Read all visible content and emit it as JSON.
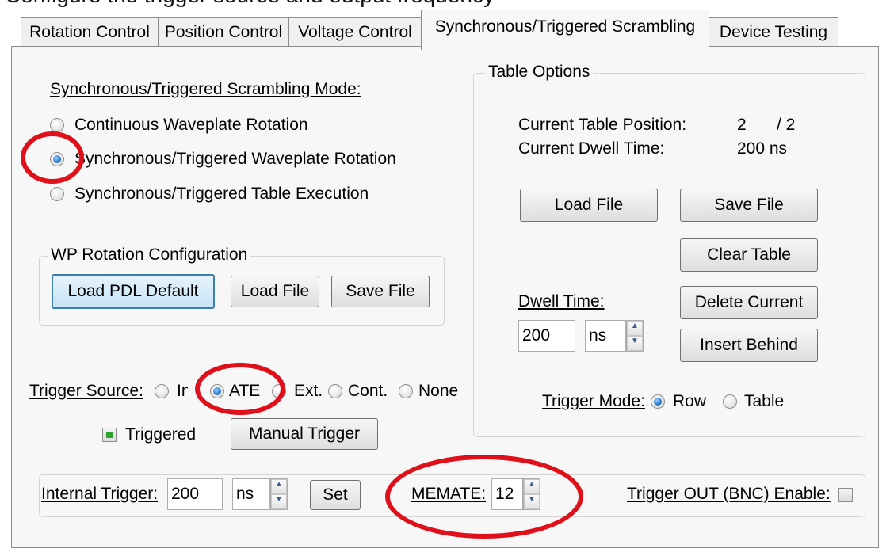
{
  "top_caption": "Configure the trigger source and output frequency",
  "tabs": [
    "Rotation Control",
    "Position Control",
    "Voltage Control",
    "Synchronous/Triggered Scrambling",
    "Device Testing"
  ],
  "mode": {
    "heading": "Synchronous/Triggered Scrambling Mode:",
    "options": [
      "Continuous Waveplate Rotation",
      "Synchronous/Triggered Waveplate Rotation",
      "Synchronous/Triggered Table Execution"
    ],
    "selected_index": 1
  },
  "wp_config": {
    "legend": "WP Rotation Configuration",
    "load_default": "Load PDL Default",
    "load_file": "Load File",
    "save_file": "Save File"
  },
  "trigger_source": {
    "label": "Trigger Source:",
    "options": [
      "Int.",
      "ATE",
      "Ext.",
      "Cont.",
      "None"
    ],
    "selected": "ATE"
  },
  "triggered": {
    "label": "Triggered",
    "checked": true
  },
  "manual_trigger": "Manual Trigger",
  "table_options": {
    "legend": "Table Options",
    "position_label": "Current Table Position:",
    "position_value": "2",
    "position_total": "/ 2",
    "dwell_label": "Current Dwell Time:",
    "dwell_value": "200 ns",
    "load_file": "Load File",
    "save_file": "Save File",
    "clear_table": "Clear Table",
    "delete_current": "Delete Current",
    "insert_behind": "Insert Behind",
    "dwell_time_label": "Dwell Time:",
    "dwell_time_value": "200",
    "dwell_unit": "ns",
    "trigger_mode_label": "Trigger Mode:",
    "trigger_modes": [
      "Row",
      "Table"
    ],
    "trigger_mode_selected": "Row"
  },
  "bottom": {
    "internal_trigger_label": "Internal Trigger:",
    "internal_trigger_value": "200",
    "internal_trigger_unit": "ns",
    "set": "Set",
    "memate_label": "MEMATE:",
    "memate_value": "12",
    "trigger_out_label": "Trigger OUT (BNC) Enable:",
    "trigger_out_checked": false
  },
  "colors": {
    "annotation": "#e0101a",
    "radio_selected": "#2f7fd0",
    "checkbox_fill": "#2ea22e"
  }
}
